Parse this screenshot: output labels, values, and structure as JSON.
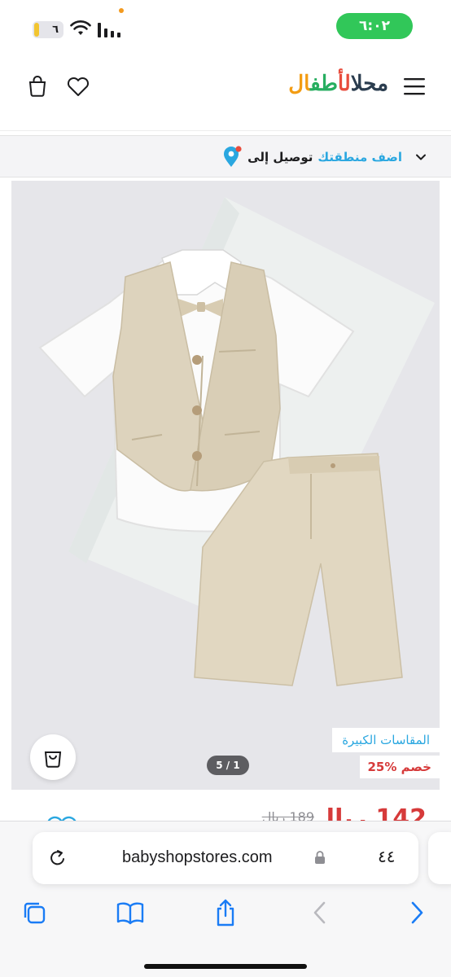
{
  "status_bar": {
    "battery_level": "٦",
    "time": "٦:٠٢",
    "icons": [
      "battery-icon",
      "wifi-icon",
      "signal-icon"
    ]
  },
  "header": {
    "logo_parts": [
      "محل",
      "الأ",
      "طف",
      "ال"
    ],
    "icons": [
      "menu-icon",
      "heart-icon",
      "cart-icon"
    ]
  },
  "delivery": {
    "label": "توصيل إلى",
    "action": "اضف منطقتك",
    "icons": [
      "location-pin-icon",
      "chevron-down-icon"
    ]
  },
  "product": {
    "size_badge": "المقاسات الكبيرة",
    "discount_badge": "25% خصم",
    "pager": "5 / 1",
    "price": "142 ريال",
    "old_price": "189 ريال",
    "colors": {
      "accent": "#2aa7e0",
      "sale": "#d63a3a"
    }
  },
  "browser": {
    "url": "babyshopstores.com",
    "text_size_label": "٤٤",
    "toolbar_icons": [
      "tabs-icon",
      "bookmarks-icon",
      "share-icon",
      "back-arrow-icon",
      "forward-arrow-icon"
    ]
  }
}
